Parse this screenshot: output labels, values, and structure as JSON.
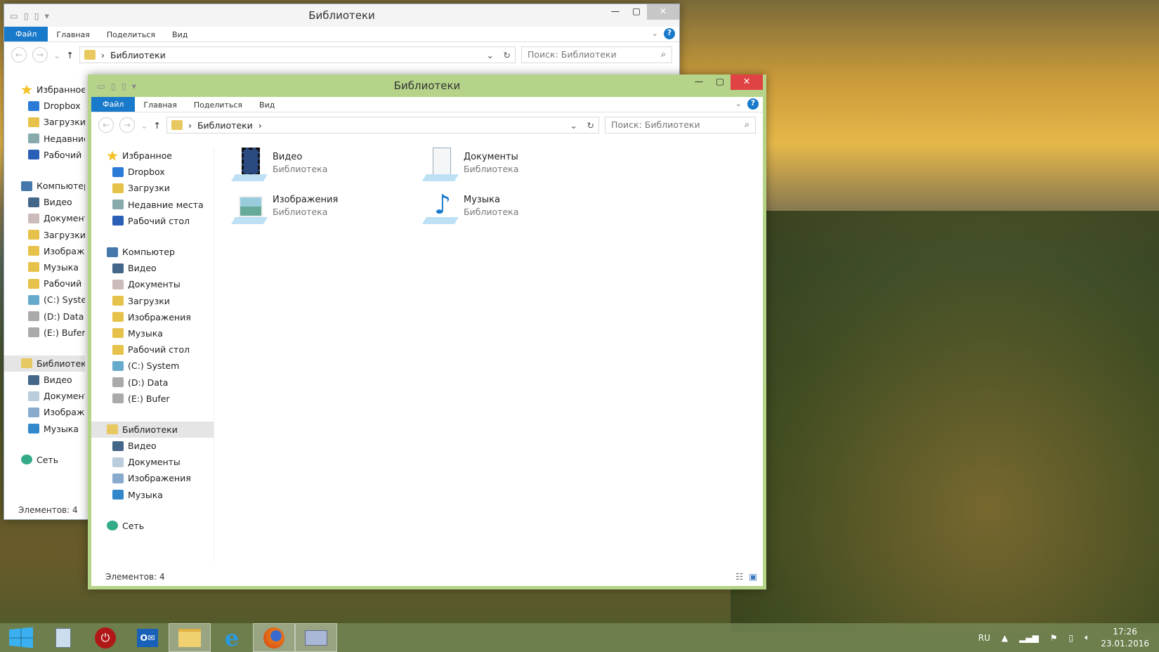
{
  "window_title": "Библиотеки",
  "ribbon": {
    "file": "Файл",
    "tabs": [
      "Главная",
      "Поделиться",
      "Вид"
    ],
    "help": "?"
  },
  "address": {
    "path": "Библиотеки",
    "search_placeholder": "Поиск: Библиотеки"
  },
  "tree": {
    "favorites": "Избранное",
    "fav_items": [
      "Dropbox",
      "Загрузки",
      "Недавние места",
      "Рабочий стол"
    ],
    "computer": "Компьютер",
    "comp_items": [
      "Видео",
      "Документы",
      "Загрузки",
      "Изображения",
      "Музыка",
      "Рабочий стол",
      "(C:) System",
      "(D:) Data",
      "(E:) Bufer"
    ],
    "libraries": "Библиотеки",
    "lib_items": [
      "Видео",
      "Документы",
      "Изображения",
      "Музыка"
    ],
    "network": "Сеть"
  },
  "items": [
    {
      "name": "Видео",
      "type": "Библиотека"
    },
    {
      "name": "Документы",
      "type": "Библиотека"
    },
    {
      "name": "Изображения",
      "type": "Библиотека"
    },
    {
      "name": "Музыка",
      "type": "Библиотека"
    }
  ],
  "status": "Элементов: 4",
  "tray": {
    "lang": "RU",
    "time": "17:26",
    "date": "23.01.2016"
  },
  "colors": {
    "accent": "#1979ca",
    "frame": "#b5d48a",
    "close": "#e04343"
  }
}
